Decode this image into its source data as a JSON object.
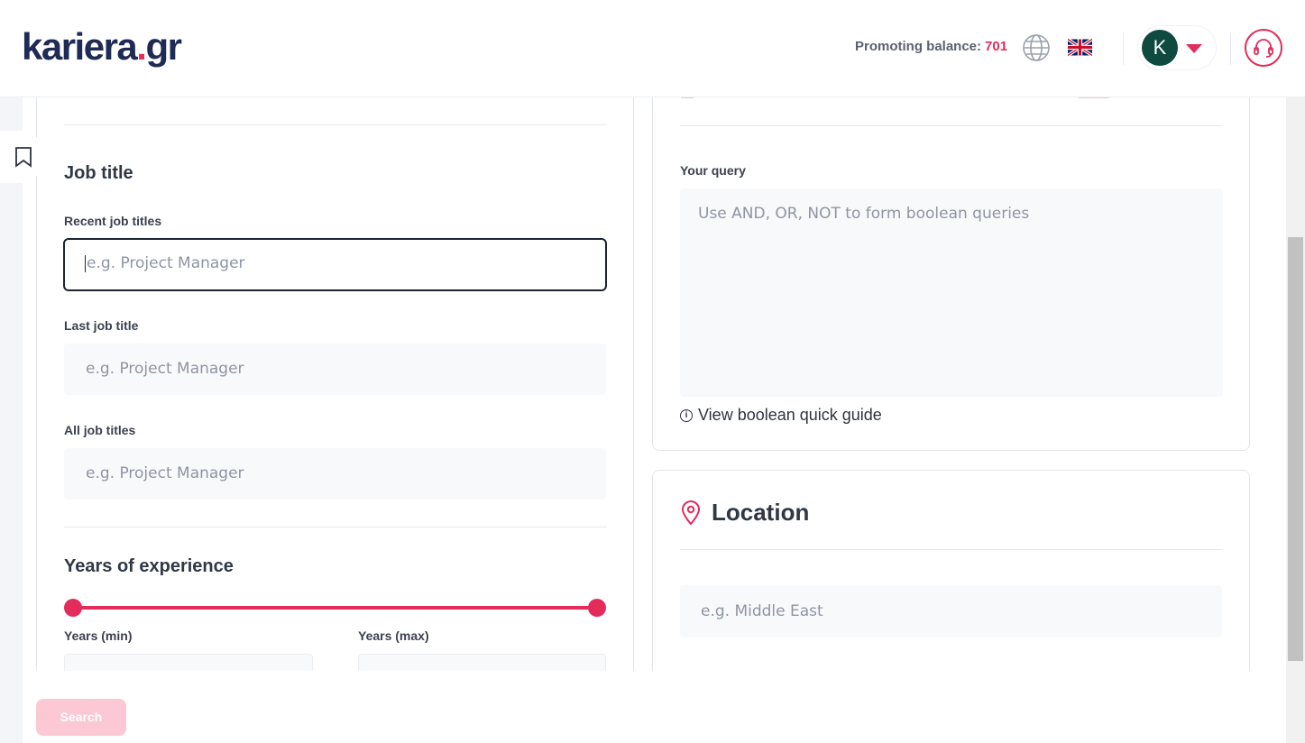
{
  "header": {
    "logo_main": "kariera",
    "logo_dot": ".",
    "logo_tld": "gr",
    "promo_label": "Promoting balance:",
    "promo_value": "701",
    "language_icon": "globe-icon",
    "flag_icon": "uk-flag-icon",
    "avatar_initial": "K",
    "support_icon": "headset-icon"
  },
  "sidebar": {
    "bookmark_icon": "bookmark-icon"
  },
  "job_title": {
    "title": "Job title",
    "recent_label": "Recent job titles",
    "recent_placeholder": "e.g. Project Manager",
    "last_label": "Last job title",
    "last_placeholder": "e.g. Project Manager",
    "all_label": "All job titles",
    "all_placeholder": "e.g. Project Manager"
  },
  "experience": {
    "title": "Years of experience",
    "min_label": "Years (min)",
    "max_label": "Years (max)",
    "range_min_fraction": 0,
    "range_max_fraction": 1
  },
  "query": {
    "label": "Your query",
    "placeholder": "Use AND, OR, NOT to form boolean queries",
    "guide_link": "View boolean quick guide"
  },
  "location": {
    "title": "Location",
    "placeholder": "e.g. Middle East"
  },
  "footer": {
    "search_label": "Search"
  },
  "colors": {
    "accent": "#e32c5b",
    "brand": "#1f2a55",
    "avatar": "#0e4a3e"
  }
}
